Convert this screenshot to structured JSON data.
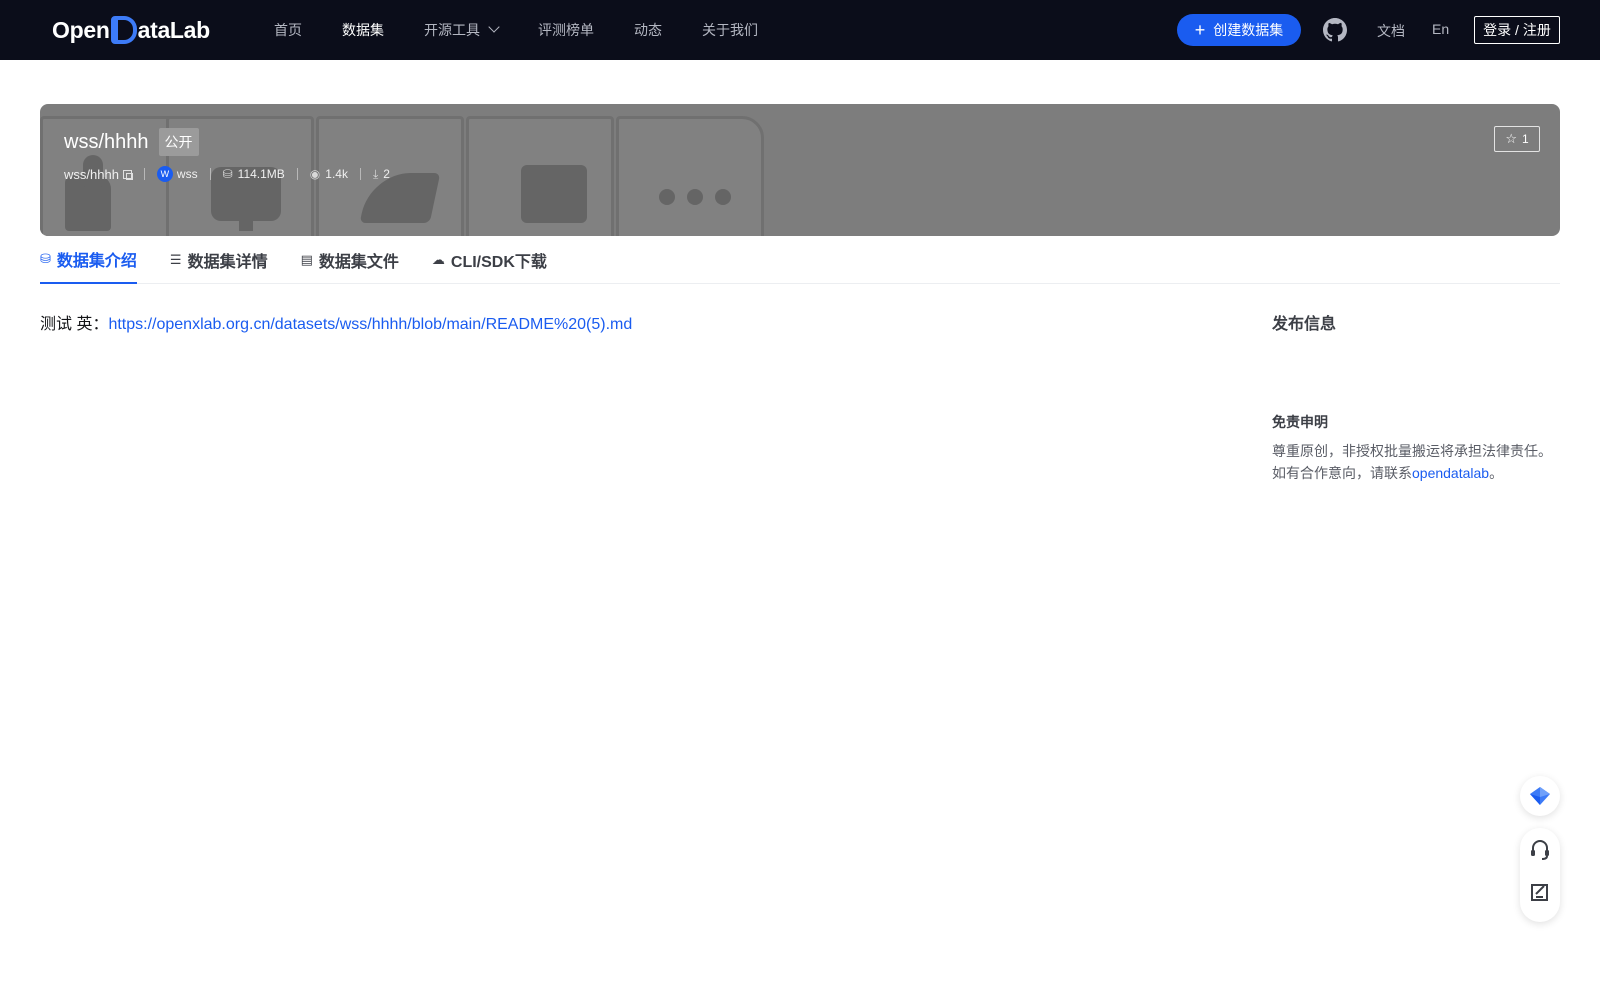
{
  "nav": {
    "logo_text_left": "Open",
    "logo_text_right": "ataLab",
    "items": [
      {
        "label": "首页"
      },
      {
        "label": "数据集"
      },
      {
        "label": "开源工具"
      },
      {
        "label": "评测榜单"
      },
      {
        "label": "动态"
      },
      {
        "label": "关于我们"
      }
    ],
    "create_label": "创建数据集",
    "doc_label": "文档",
    "lang_label": "En",
    "login_label": "登录 / 注册",
    "accent": "#1a5cf0"
  },
  "dataset": {
    "title": "wss/hhhh",
    "visibility": "公开",
    "repo": "wss/hhhh",
    "owner_initial": "W",
    "owner": "wss",
    "size": "114.1MB",
    "views": "1.4k",
    "downloads": "2",
    "stars": "1"
  },
  "tabs": [
    {
      "label": "数据集介绍"
    },
    {
      "label": "数据集详情"
    },
    {
      "label": "数据集文件"
    },
    {
      "label": "CLI/SDK下载"
    }
  ],
  "readme": {
    "prefix": "测试 英：",
    "link_text": "https://openxlab.org.cn/datasets/wss/hhhh/blob/main/README%20(5).md"
  },
  "aside": {
    "publish_title": "发布信息",
    "disclaimer_title": "免责申明",
    "disclaimer_line1": "尊重原创，非授权批量搬运将承担法律责任。",
    "disclaimer_line2_prefix": "如有合作意向，请联系",
    "disclaimer_link": "opendatalab",
    "disclaimer_line2_suffix": "。"
  }
}
